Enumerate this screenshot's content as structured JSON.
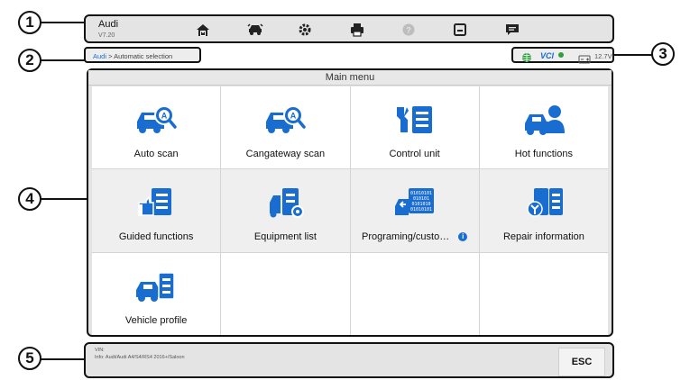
{
  "callouts": [
    "1",
    "2",
    "3",
    "4",
    "5"
  ],
  "toolbar": {
    "title": "Audi",
    "version": "V7.20",
    "buttons": [
      "home-icon",
      "vehicle-swap-icon",
      "settings-icon",
      "print-icon",
      "help-icon",
      "save-icon",
      "message-icon"
    ]
  },
  "breadcrumb": {
    "link": "Audi",
    "separator": " > ",
    "current": "Automatic selection"
  },
  "status": {
    "vci": "VCI",
    "voltage": "12.7V",
    "indicators": [
      "network-icon",
      "vci-icon",
      "battery-icon"
    ]
  },
  "main": {
    "title": "Main menu",
    "items": [
      {
        "label": "Auto scan",
        "icon": "auto-scan-icon"
      },
      {
        "label": "Cangateway scan",
        "icon": "cangateway-scan-icon"
      },
      {
        "label": "Control unit",
        "icon": "control-unit-icon"
      },
      {
        "label": "Hot functions",
        "icon": "hot-functions-icon"
      },
      {
        "label": "Guided functions",
        "icon": "guided-functions-icon"
      },
      {
        "label": "Equipment list",
        "icon": "equipment-list-icon"
      },
      {
        "label": "Programing/custo…",
        "icon": "programming-icon",
        "badge": "i"
      },
      {
        "label": "Repair information",
        "icon": "repair-information-icon"
      },
      {
        "label": "Vehicle profile",
        "icon": "vehicle-profile-icon"
      }
    ]
  },
  "footer": {
    "vin_label": "VIN:",
    "info": "Info: Audi/Audi A4/S4/RS4 2016+/Saloon",
    "esc": "ESC"
  },
  "colors": {
    "accent": "#1a6dd0",
    "green": "#2e9e3e",
    "panel": "#e4e4e4"
  }
}
